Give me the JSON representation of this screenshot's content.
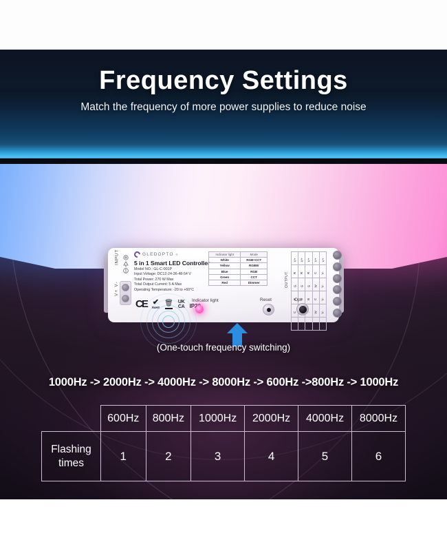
{
  "header": {
    "title": "Frequency Settings",
    "subtitle": "Match the frequency of more power supplies to reduce noise"
  },
  "device": {
    "brand": "GLEDOPTO",
    "brand_superscript": "®",
    "product_name": "5 in 1 Smart LED Controller",
    "specs": [
      "Model NO.: GL-C-001P",
      "Input Voltage: DC12-24-36-48-54 V",
      "Total Power: 270 W Max",
      "Total Output Current: 5 A Max",
      "Operating Temperature: -20 to +60°C"
    ],
    "input_label": "INPUT",
    "input_terminals": "V+  V-",
    "output_label": "OUTPUT",
    "certifications": [
      "CE",
      "RoHS",
      "WEEE",
      "UKCA",
      "IP20"
    ],
    "cert_ce": "CE",
    "cert_rohs": "RoHS",
    "cert_ukca_top": "UK",
    "cert_ukca_bottom": "CA",
    "cert_ip": "IP20",
    "mode_table": {
      "headers": [
        "Indicator light",
        "Mode"
      ],
      "rows": [
        [
          "White",
          "RGB+CCT"
        ],
        [
          "Yellow",
          "RGBW"
        ],
        [
          "Blue",
          "RGB"
        ],
        [
          "Green",
          "CCT"
        ],
        [
          "Red",
          "Dimmer"
        ]
      ]
    },
    "output_table": {
      "rows": [
        [
          "V+",
          "V+",
          "V+",
          "V+",
          "V+"
        ],
        [
          "R",
          "R",
          "R",
          "C",
          "V-"
        ],
        [
          "G",
          "G",
          "G",
          "W",
          "V-"
        ],
        [
          "B",
          "B",
          "B",
          "C",
          "V-"
        ],
        [
          "C",
          "W",
          "-",
          "W",
          "V-"
        ],
        [
          "W",
          "-",
          "-",
          "-",
          "V-"
        ]
      ]
    },
    "controls": {
      "indicator_label": "Indicator light",
      "reset_label": "Reset",
      "opt_label": "Opt"
    }
  },
  "callout": {
    "one_touch": "(One-touch frequency switching)",
    "sequence": "1000Hz -> 2000Hz -> 4000Hz -> 8000Hz -> 600Hz ->800Hz -> 1000Hz"
  },
  "freq_table": {
    "row_label": "Flashing",
    "row_label2": "times",
    "frequencies": [
      "600Hz",
      "800Hz",
      "1000Hz",
      "2000Hz",
      "4000Hz",
      "8000Hz"
    ],
    "flashing_times": [
      "1",
      "2",
      "3",
      "4",
      "5",
      "6"
    ]
  },
  "colors": {
    "accent_cyan": "#3fb6ef",
    "accent_pink": "#f03fb4",
    "arrow_blue": "#2b8ede",
    "panel_blue": "#79aefc",
    "panel_pink": "#f97fcf"
  }
}
